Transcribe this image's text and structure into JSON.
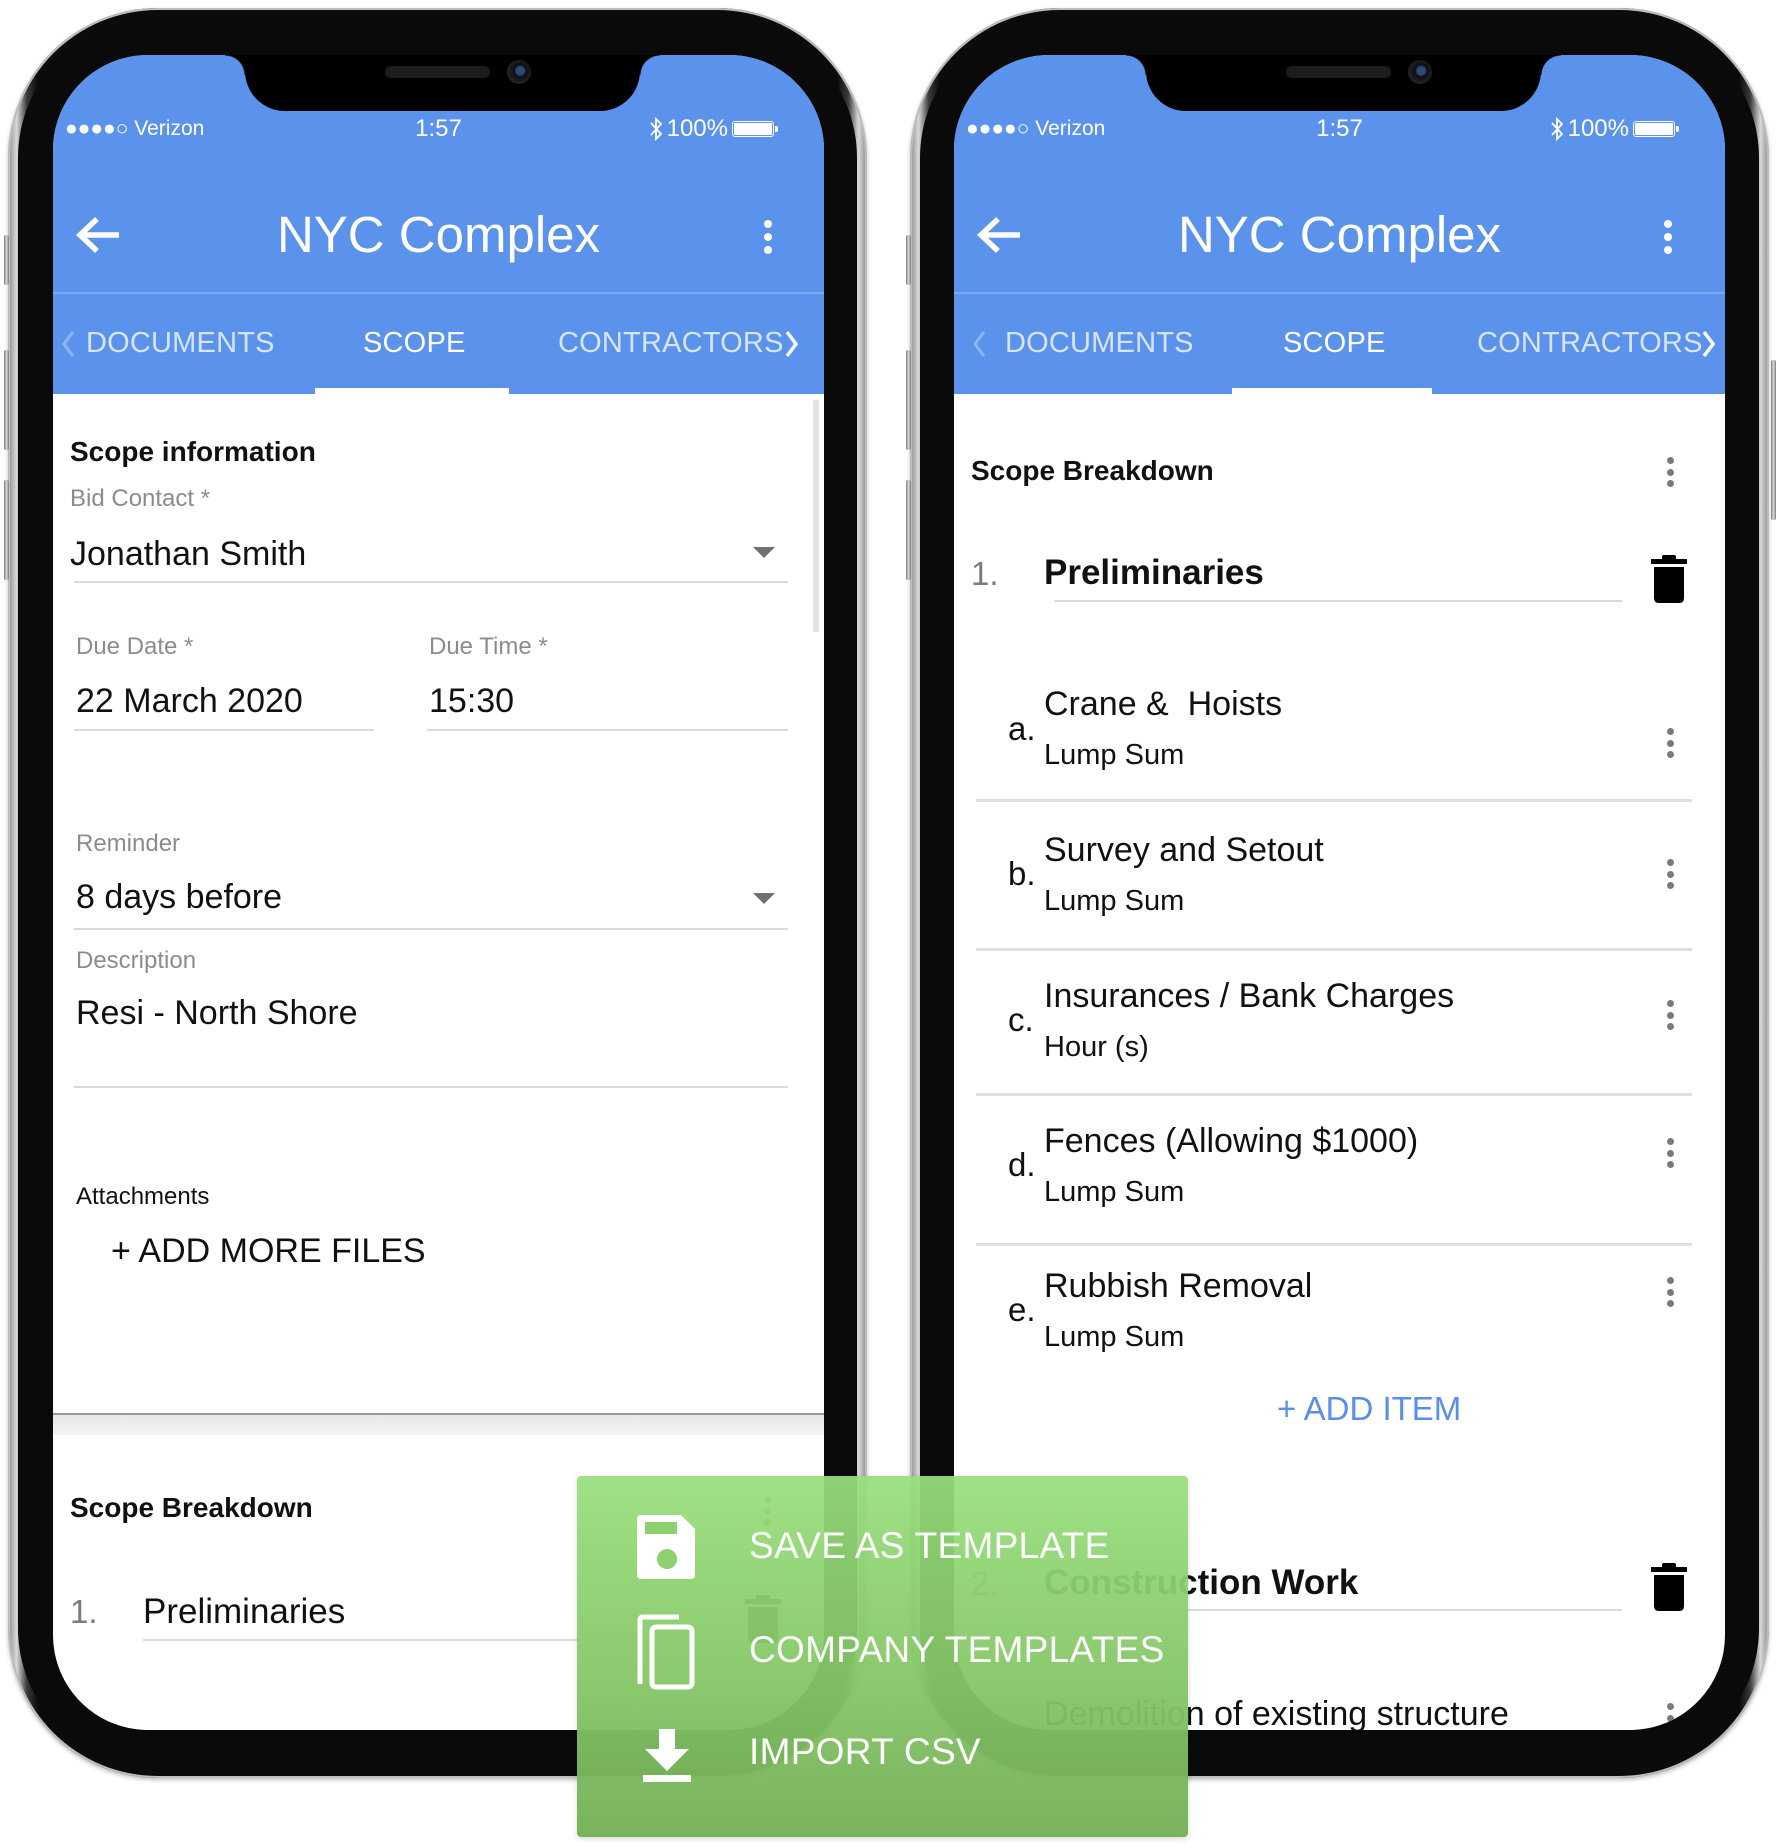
{
  "status_bar": {
    "carrier": "●●●●○ Verizon",
    "time": "1:57",
    "battery": "100%",
    "battery_level": 1.0,
    "bluetooth": "bluetooth-icon"
  },
  "app_bar": {
    "title": "NYC Complex",
    "back_icon": "arrow-back-icon",
    "menu_icon": "more-vert-icon"
  },
  "tabs": [
    {
      "label": "DOCUMENTS",
      "active": false
    },
    {
      "label": "SCOPE",
      "active": true
    },
    {
      "label": "CONTRACTORS",
      "active": false
    }
  ],
  "colors": {
    "primary": "#5a92ec",
    "accent_link": "#5a8eea",
    "overlay_green": "#8ccb6e",
    "text": "#111111",
    "label": "#8c8c8c"
  },
  "left_screen": {
    "scope_info": {
      "heading": "Scope information",
      "bid_contact": {
        "label": "Bid Contact *",
        "value": "Jonathan Smith"
      },
      "due_date": {
        "label": "Due Date *",
        "value": "22 March 2020"
      },
      "due_time": {
        "label": "Due Time *",
        "value": "15:30"
      },
      "reminder": {
        "label": "Reminder",
        "value": "8 days before"
      },
      "description": {
        "label": "Description",
        "value": "Resi - North Shore"
      },
      "attachments": {
        "label": "Attachments",
        "add_button": "+ ADD MORE FILES"
      }
    },
    "scope_breakdown": {
      "heading": "Scope Breakdown",
      "groups": [
        {
          "number": "1.",
          "title": "Preliminaries"
        }
      ]
    }
  },
  "right_screen": {
    "scope_breakdown": {
      "heading": "Scope Breakdown",
      "groups": [
        {
          "number": "1.",
          "title": "Preliminaries",
          "items": [
            {
              "letter": "a.",
              "title": "Crane &  Hoists",
              "unit": "Lump Sum"
            },
            {
              "letter": "b.",
              "title": "Survey and Setout",
              "unit": "Lump Sum"
            },
            {
              "letter": "c.",
              "title": "Insurances / Bank Charges",
              "unit": "Hour (s)"
            },
            {
              "letter": "d.",
              "title": "Fences (Allowing $1000)",
              "unit": "Lump Sum"
            },
            {
              "letter": "e.",
              "title": "Rubbish Removal",
              "unit": "Lump Sum"
            }
          ],
          "add_item": "+ ADD ITEM"
        },
        {
          "number": "2.",
          "title": "Construction Work",
          "items": [
            {
              "title": "Demolition of existing structure"
            }
          ]
        }
      ]
    }
  },
  "overlay_menu": {
    "items": [
      {
        "icon": "save-icon",
        "label": "SAVE AS TEMPLATE"
      },
      {
        "icon": "copy-templates-icon",
        "label": "COMPANY TEMPLATES"
      },
      {
        "icon": "download-icon",
        "label": "IMPORT CSV"
      }
    ]
  }
}
